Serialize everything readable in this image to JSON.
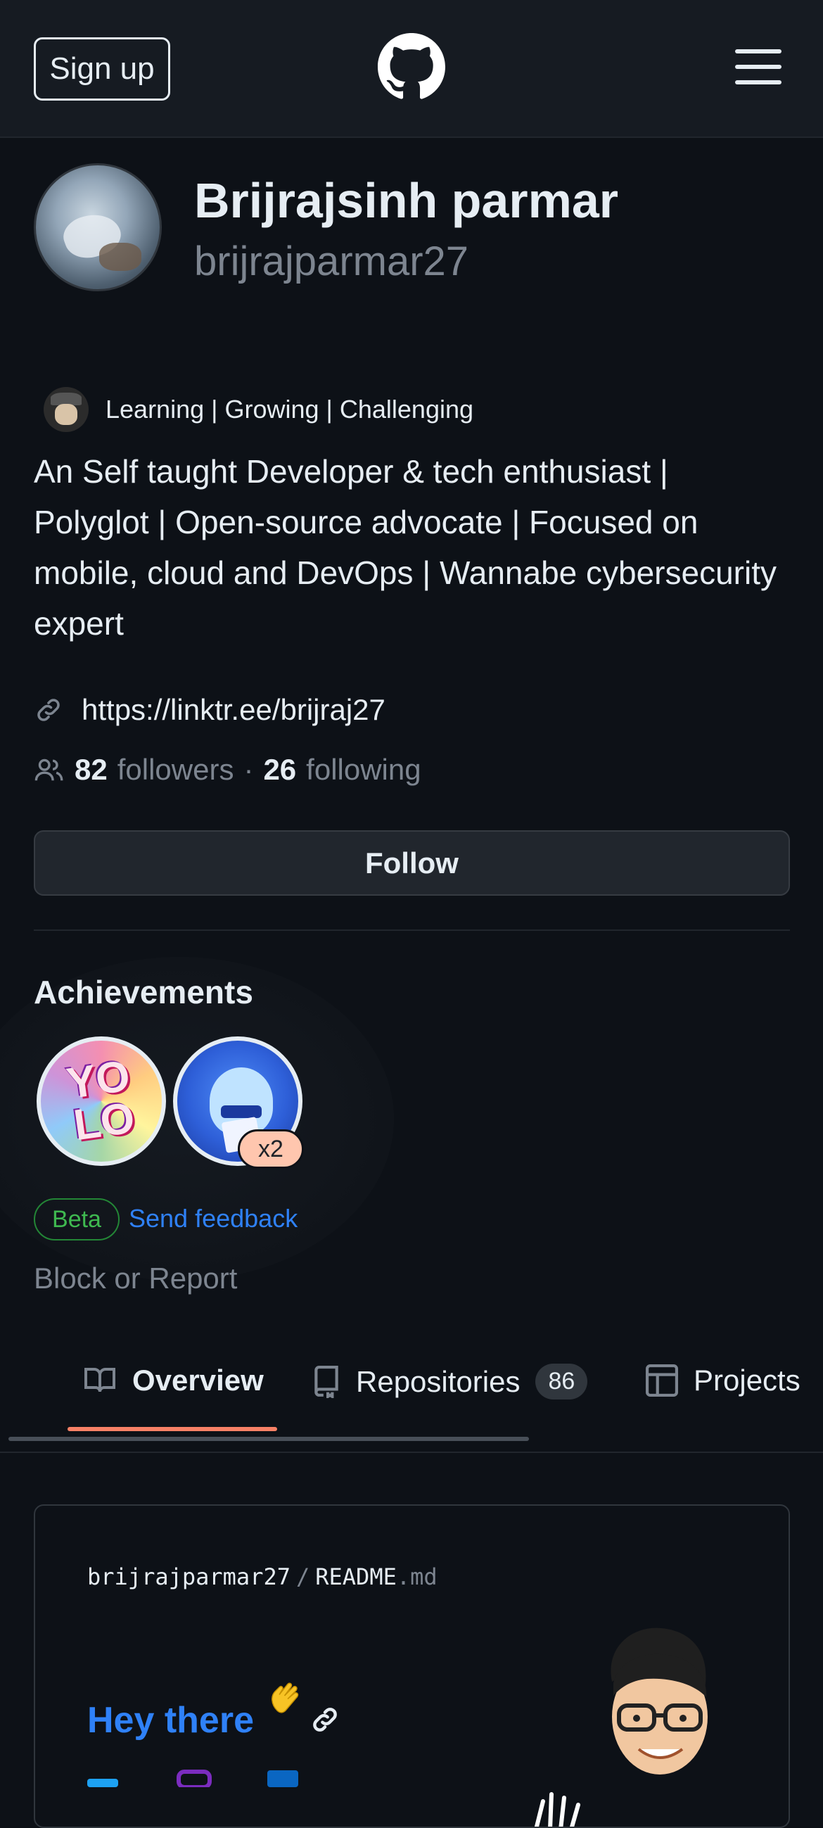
{
  "header": {
    "signup_label": "Sign up"
  },
  "profile": {
    "name": "Brijrajsinh parmar",
    "username": "brijrajparmar27",
    "status": "Learning | Growing | Challenging",
    "bio": "An Self taught Developer & tech enthusiast | Polyglot | Open-source advocate | Focused on mobile, cloud and DevOps | Wannabe cybersecurity expert",
    "website": "https://linktr.ee/brijraj27",
    "followers_count": "82",
    "followers_label": "followers",
    "separator": "·",
    "following_count": "26",
    "following_label": "following",
    "follow_button": "Follow"
  },
  "achievements": {
    "title": "Achievements",
    "badges": [
      {
        "name": "YOLO",
        "text": "YO LO"
      },
      {
        "name": "Shark",
        "multiplier": "x2"
      }
    ],
    "beta_label": "Beta",
    "feedback_label": "Send feedback"
  },
  "block_label": "Block or Report",
  "tabs": [
    {
      "label": "Overview",
      "icon": "book-icon",
      "active": true
    },
    {
      "label": "Repositories",
      "icon": "repo-icon",
      "count": "86"
    },
    {
      "label": "Projects",
      "icon": "table-icon"
    }
  ],
  "readme": {
    "owner": "brijrajparmar27",
    "separator": "/",
    "file": "README",
    "ext": ".md",
    "heading": "Hey there"
  },
  "colors": {
    "background": "#0d1117",
    "header": "#161b22",
    "link": "#2f81f7",
    "muted": "#7d8590",
    "tab_underline": "#f78166",
    "beta_green": "#3fb950"
  }
}
